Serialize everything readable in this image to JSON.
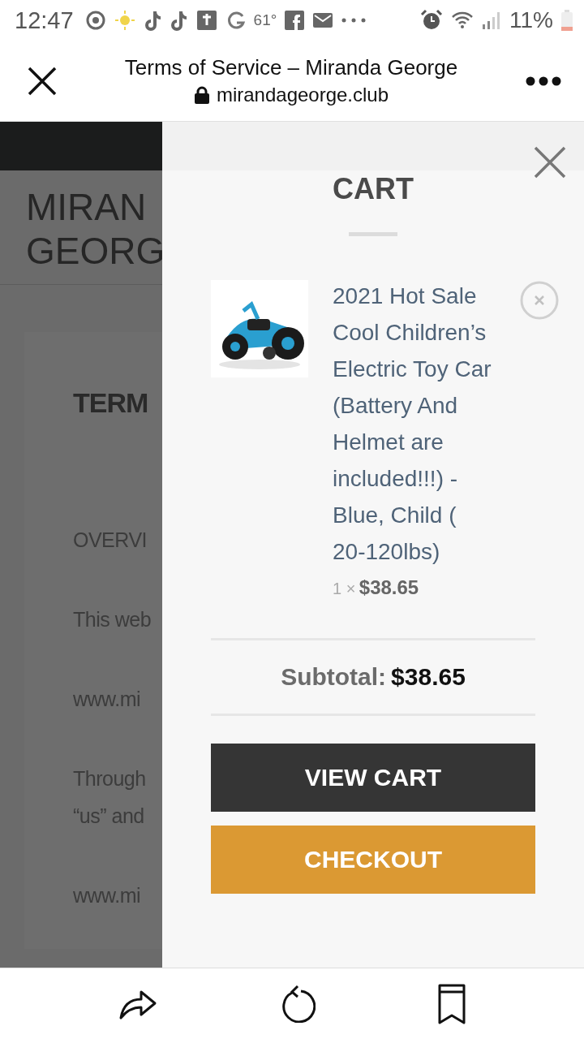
{
  "status_bar": {
    "time": "12:47",
    "temperature": "61°",
    "battery": "11%"
  },
  "browser": {
    "title": "Terms of Service – Miranda George",
    "url": "mirandageorge.club"
  },
  "page": {
    "logo_lines": [
      "MIRAN",
      "GEORG"
    ],
    "heading": "TERM",
    "paragraphs": [
      [
        "OVERVI"
      ],
      [
        "This web"
      ],
      [
        "www.mi"
      ],
      [
        "Through",
        "“us” and"
      ],
      [
        "www.mi"
      ]
    ]
  },
  "cart": {
    "title": "CART",
    "items": [
      {
        "name": "2021 Hot Sale Cool Children’s Electric Toy Car (Battery And Helmet are included!!!) - Blue, Child ( 20-120lbs)",
        "quantity": "1 ×",
        "price": "$38.65"
      }
    ],
    "subtotal_label": "Subtotal:",
    "subtotal": "$38.65",
    "buttons": [
      {
        "label": "VIEW CART",
        "kind": "secondary"
      },
      {
        "label": "CHECKOUT",
        "kind": "primary"
      }
    ]
  }
}
